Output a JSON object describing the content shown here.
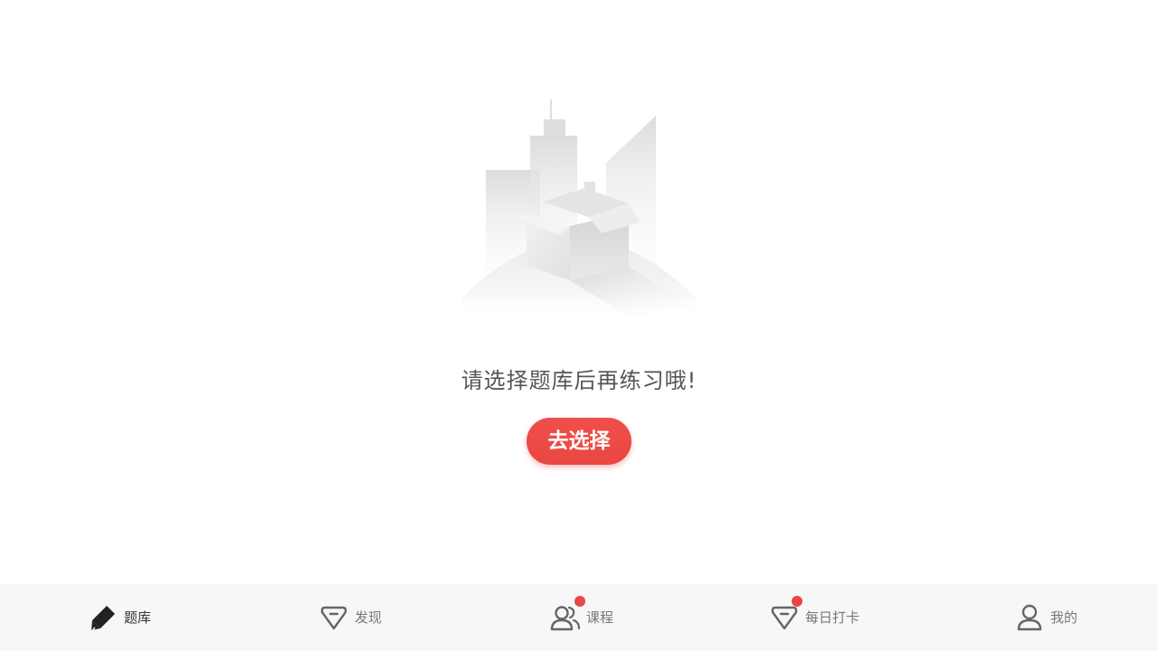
{
  "colors": {
    "accent": "#ea4643",
    "badge": "#ea4643",
    "tabbar_background": "#f7f7f7",
    "text_primary": "#333333",
    "text_secondary": "#777777",
    "message_text": "#555555"
  },
  "empty_state": {
    "illustration": "empty-box-city-illustration",
    "message": "请选择题库后再练习哦!",
    "button_label": "去选择"
  },
  "tabbar": {
    "tabs": [
      {
        "label": "题库",
        "icon": "pencil-icon",
        "active": true,
        "badge": false
      },
      {
        "label": "发现",
        "icon": "diamond-icon",
        "active": false,
        "badge": false
      },
      {
        "label": "课程",
        "icon": "people-icon",
        "active": false,
        "badge": true
      },
      {
        "label": "每日打卡",
        "icon": "diamond-icon",
        "active": false,
        "badge": true
      },
      {
        "label": "我的",
        "icon": "person-icon",
        "active": false,
        "badge": false
      }
    ]
  }
}
